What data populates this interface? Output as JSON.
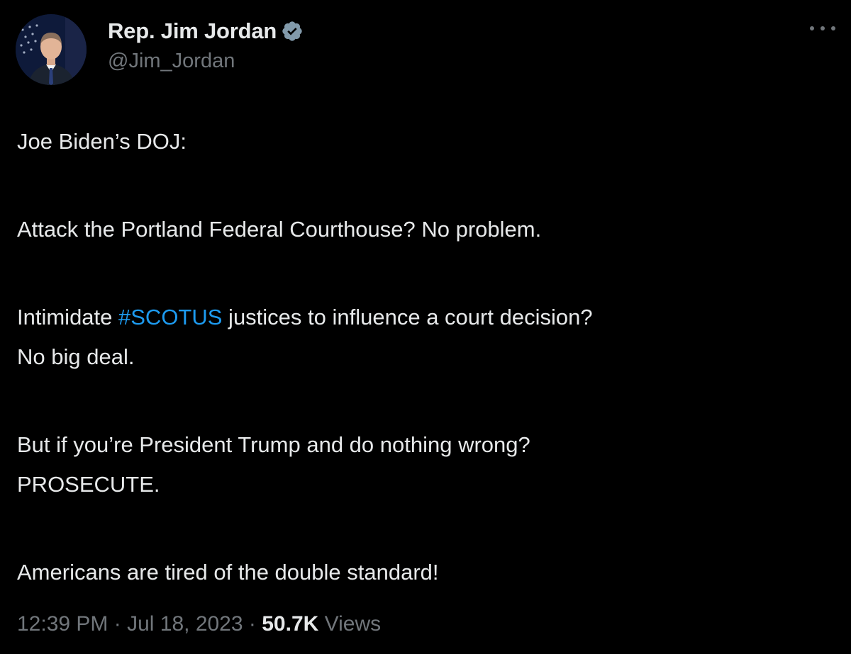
{
  "author": {
    "display_name": "Rep. Jim Jordan",
    "handle": "@Jim_Jordan",
    "verified_icon": "verified-badge-icon",
    "avatar_icon": "profile-photo"
  },
  "tweet": {
    "line1": "Joe Biden’s DOJ:",
    "line2": "Attack the Portland Federal Courthouse? No problem.",
    "line3_prefix": "Intimidate ",
    "line3_hashtag": "#SCOTUS",
    "line3_suffix": " justices to influence a court decision?",
    "line4": "No big deal.",
    "line5": "But if you’re President Trump and do nothing wrong?",
    "line6": "PROSECUTE.",
    "line7": "Americans are tired of the double standard!"
  },
  "meta": {
    "time": "12:39 PM",
    "separator": " · ",
    "date": "Jul 18, 2023",
    "views_count": "50.7K",
    "views_label": " Views"
  },
  "colors": {
    "background": "#000000",
    "text": "#e7e9ea",
    "muted": "#71767b",
    "link": "#1d9bf0",
    "badge": "#829aab"
  }
}
